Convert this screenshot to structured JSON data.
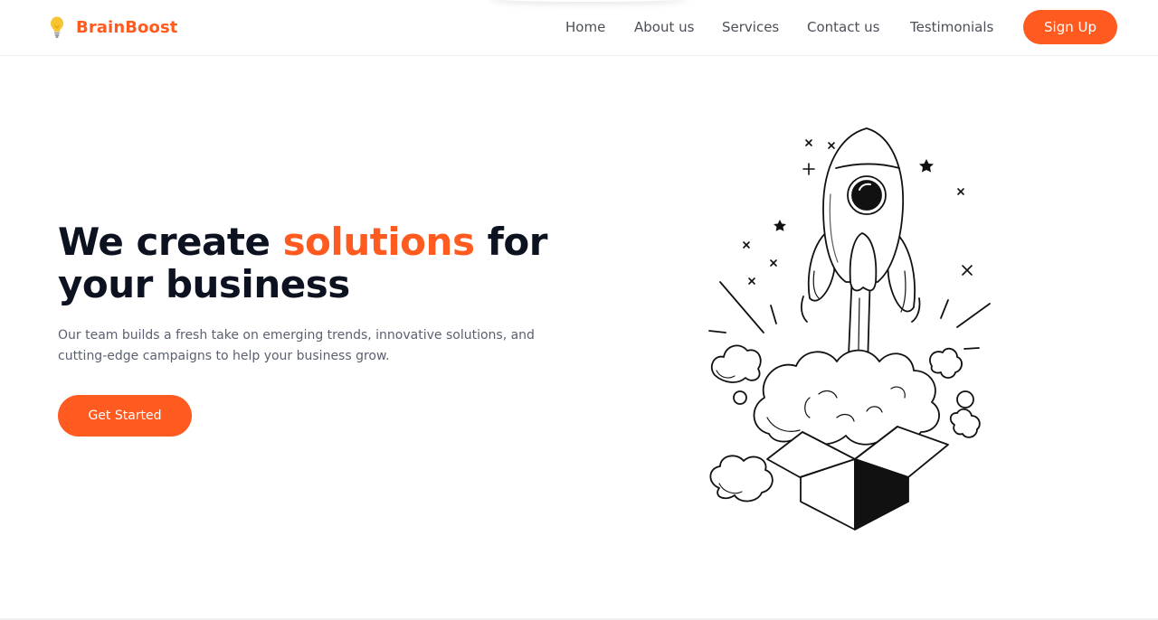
{
  "brand": {
    "name": "BrainBoost",
    "icon": "lightbulb-icon",
    "accent": "#ff5a1f",
    "bulb_color": "#f7c531"
  },
  "nav": {
    "items": [
      {
        "label": "Home"
      },
      {
        "label": "About us"
      },
      {
        "label": "Services"
      },
      {
        "label": "Contact us"
      },
      {
        "label": "Testimonials"
      }
    ],
    "signup_label": "Sign Up"
  },
  "hero": {
    "title_part1": "We create ",
    "title_accent": "solutions",
    "title_part2": " for your business",
    "description": "Our team builds a fresh take on emerging trends, innovative solutions, and cutting-edge campaigns to help your business grow.",
    "cta_label": "Get Started",
    "illustration": "rocket-launch-from-box-illustration"
  }
}
